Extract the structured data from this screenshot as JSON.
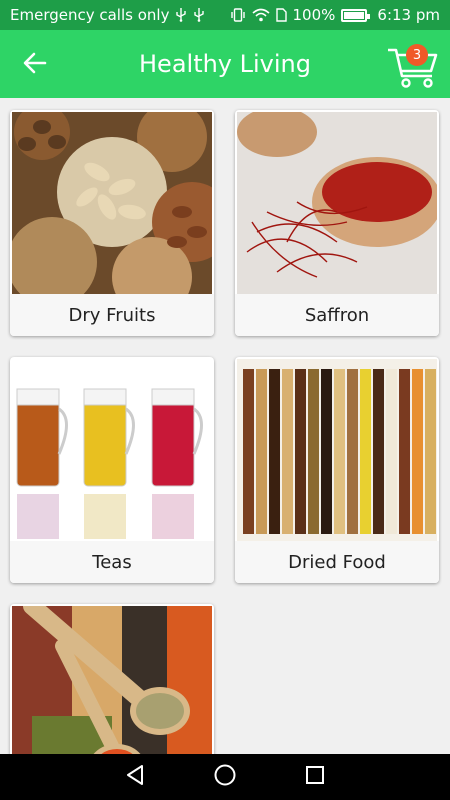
{
  "status_bar": {
    "carrier_text": "Emergency calls only",
    "battery": "100%",
    "time": "6:13 pm"
  },
  "app_bar": {
    "title": "Healthy Living",
    "cart_count": "3",
    "back_icon": "arrow-left-icon",
    "cart_icon": "shopping-cart-icon"
  },
  "categories": [
    {
      "label": "Dry Fruits"
    },
    {
      "label": "Saffron"
    },
    {
      "label": "Teas"
    },
    {
      "label": "Dried Food"
    },
    {
      "label": ""
    }
  ],
  "nav_bar": {
    "back_icon": "triangle-back-icon",
    "home_icon": "circle-home-icon",
    "recents_icon": "square-recents-icon"
  },
  "colors": {
    "status_bar": "#1e9e48",
    "app_bar": "#2ed466",
    "badge": "#f05a28"
  }
}
